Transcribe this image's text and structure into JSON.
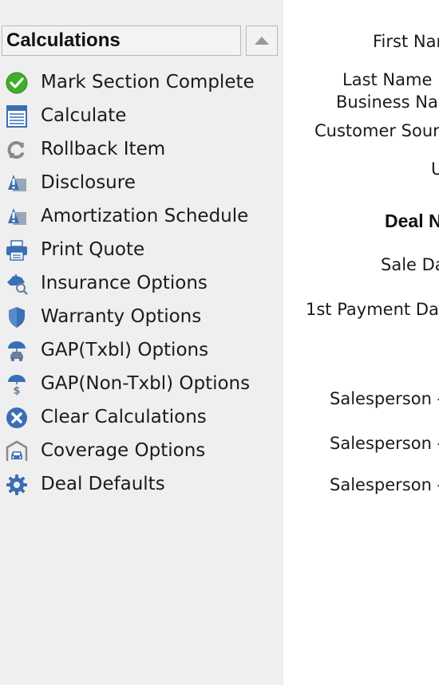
{
  "sidebar": {
    "title": "Calculations",
    "items": [
      {
        "label": "Mark Section Complete",
        "icon": "check-circle-icon"
      },
      {
        "label": "Calculate",
        "icon": "calculator-icon"
      },
      {
        "label": "Rollback Item",
        "icon": "rollback-icon"
      },
      {
        "label": "Disclosure",
        "icon": "disclosure-icon"
      },
      {
        "label": "Amortization Schedule",
        "icon": "amortization-icon"
      },
      {
        "label": "Print Quote",
        "icon": "printer-icon"
      },
      {
        "label": "Insurance Options",
        "icon": "insurance-icon"
      },
      {
        "label": "Warranty Options",
        "icon": "shield-icon"
      },
      {
        "label": "GAP(Txbl) Options",
        "icon": "umbrella-car-icon"
      },
      {
        "label": "GAP(Non-Txbl) Options",
        "icon": "umbrella-dollar-icon"
      },
      {
        "label": "Clear Calculations",
        "icon": "close-circle-icon"
      },
      {
        "label": "Coverage Options",
        "icon": "car-garage-icon"
      },
      {
        "label": "Deal Defaults",
        "icon": "gear-icon"
      }
    ]
  },
  "form": {
    "first_name": "First Nar",
    "last_name": "Last Name",
    "business_name": "Business Nar",
    "customer_source": "Customer Sour",
    "u_label": "U",
    "deal_heading": "Deal N",
    "sale_date": "Sale Da",
    "first_payment_date": "1st Payment Da",
    "salesperson_1": "Salesperson -",
    "salesperson_2": "Salesperson -",
    "salesperson_3": "Salesperson -"
  },
  "colors": {
    "sidebar_bg": "#efefef",
    "icon_blue": "#3a6fb5",
    "icon_green": "#3fae2a",
    "icon_gray": "#7a7a7a"
  }
}
